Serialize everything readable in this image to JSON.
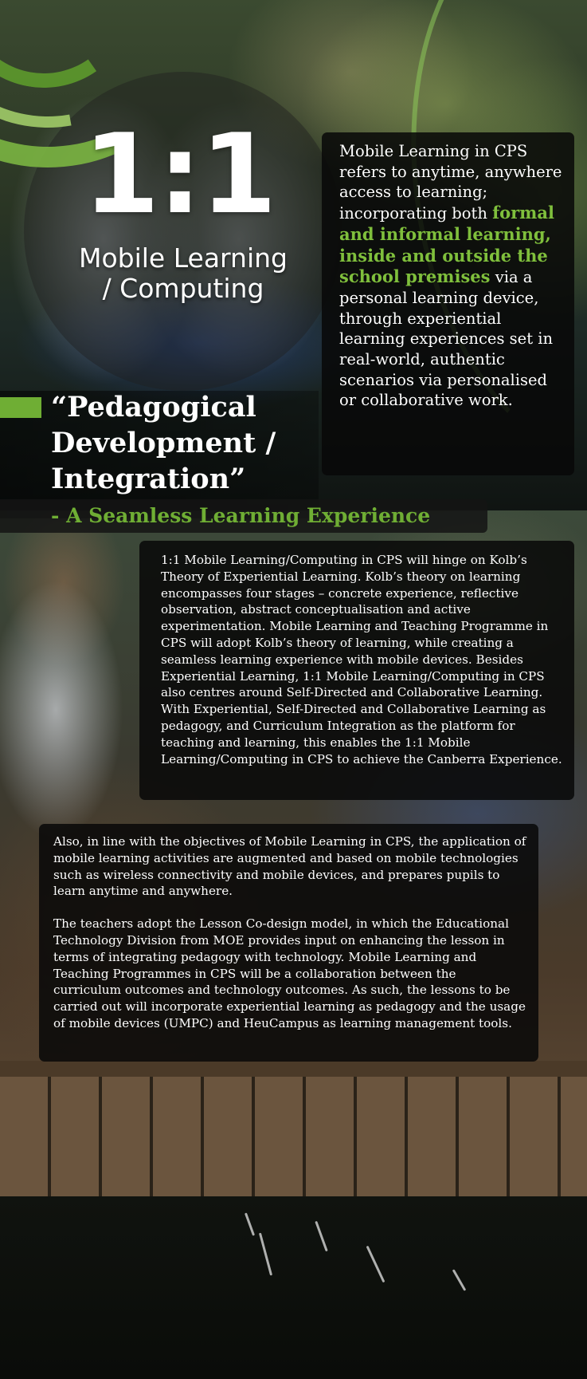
{
  "hero": {
    "ratio": "1:1",
    "subtitle_line1": "Mobile Learning",
    "subtitle_line2": "/ Computing"
  },
  "definition": {
    "intro": "Mobile Learning in CPS refers to anytime, anywhere access to learning; incorporating both ",
    "highlight": "formal and informal learning, inside and outside the school premises",
    "outro": " via a personal learning device, through experiential learning experiences set in real-world, authentic scenarios via personalised or collaborative work."
  },
  "heading": {
    "title_line1": "“Pedagogical",
    "title_line2": "Development /",
    "title_line3": "Integration”",
    "tagline": "- A Seamless Learning Experience"
  },
  "kolb": {
    "text": "1:1 Mobile Learning/Computing in CPS will hinge on Kolb’s Theory of Experiential Learning. Kolb’s theory on learning encompasses four stages – concrete experience, reflective observation, abstract conceptualisation and active experimentation. Mobile Learning and Teaching Programme in CPS will adopt Kolb’s theory of learning, while creating a seamless learning experience with mobile devices. Besides Experiential Learning, 1:1 Mobile Learning/Computing in CPS also centres around Self-Directed and Collaborative Learning. With Experiential, Self-Directed and Collaborative Learning as pedagogy, and Curriculum Integration as the platform for teaching and learning, this enables the 1:1 Mobile Learning/Computing in CPS to achieve the Canberra Experience."
  },
  "also": {
    "para1": "Also, in line with the objectives of Mobile Learning in CPS, the application of mobile learning activities are augmented and based on mobile technologies such as wireless connectivity and mobile devices, and prepares pupils to learn anytime and anywhere.",
    "para2": "The teachers adopt the Lesson Co-design model, in which the Educational Technology Division from MOE provides input on enhancing the lesson in terms of integrating pedagogy with technology. Mobile Learning and Teaching Programmes in CPS will be a collaboration between the curriculum outcomes and technology outcomes. As such, the lessons to be carried out will incorporate experiential learning as pedagogy and the usage of mobile devices (UMPC) and HeuCampus as learning management tools."
  },
  "colors": {
    "accent_green": "#6fae34",
    "highlight_green": "#7fbf3c",
    "box_background": "#080808"
  }
}
